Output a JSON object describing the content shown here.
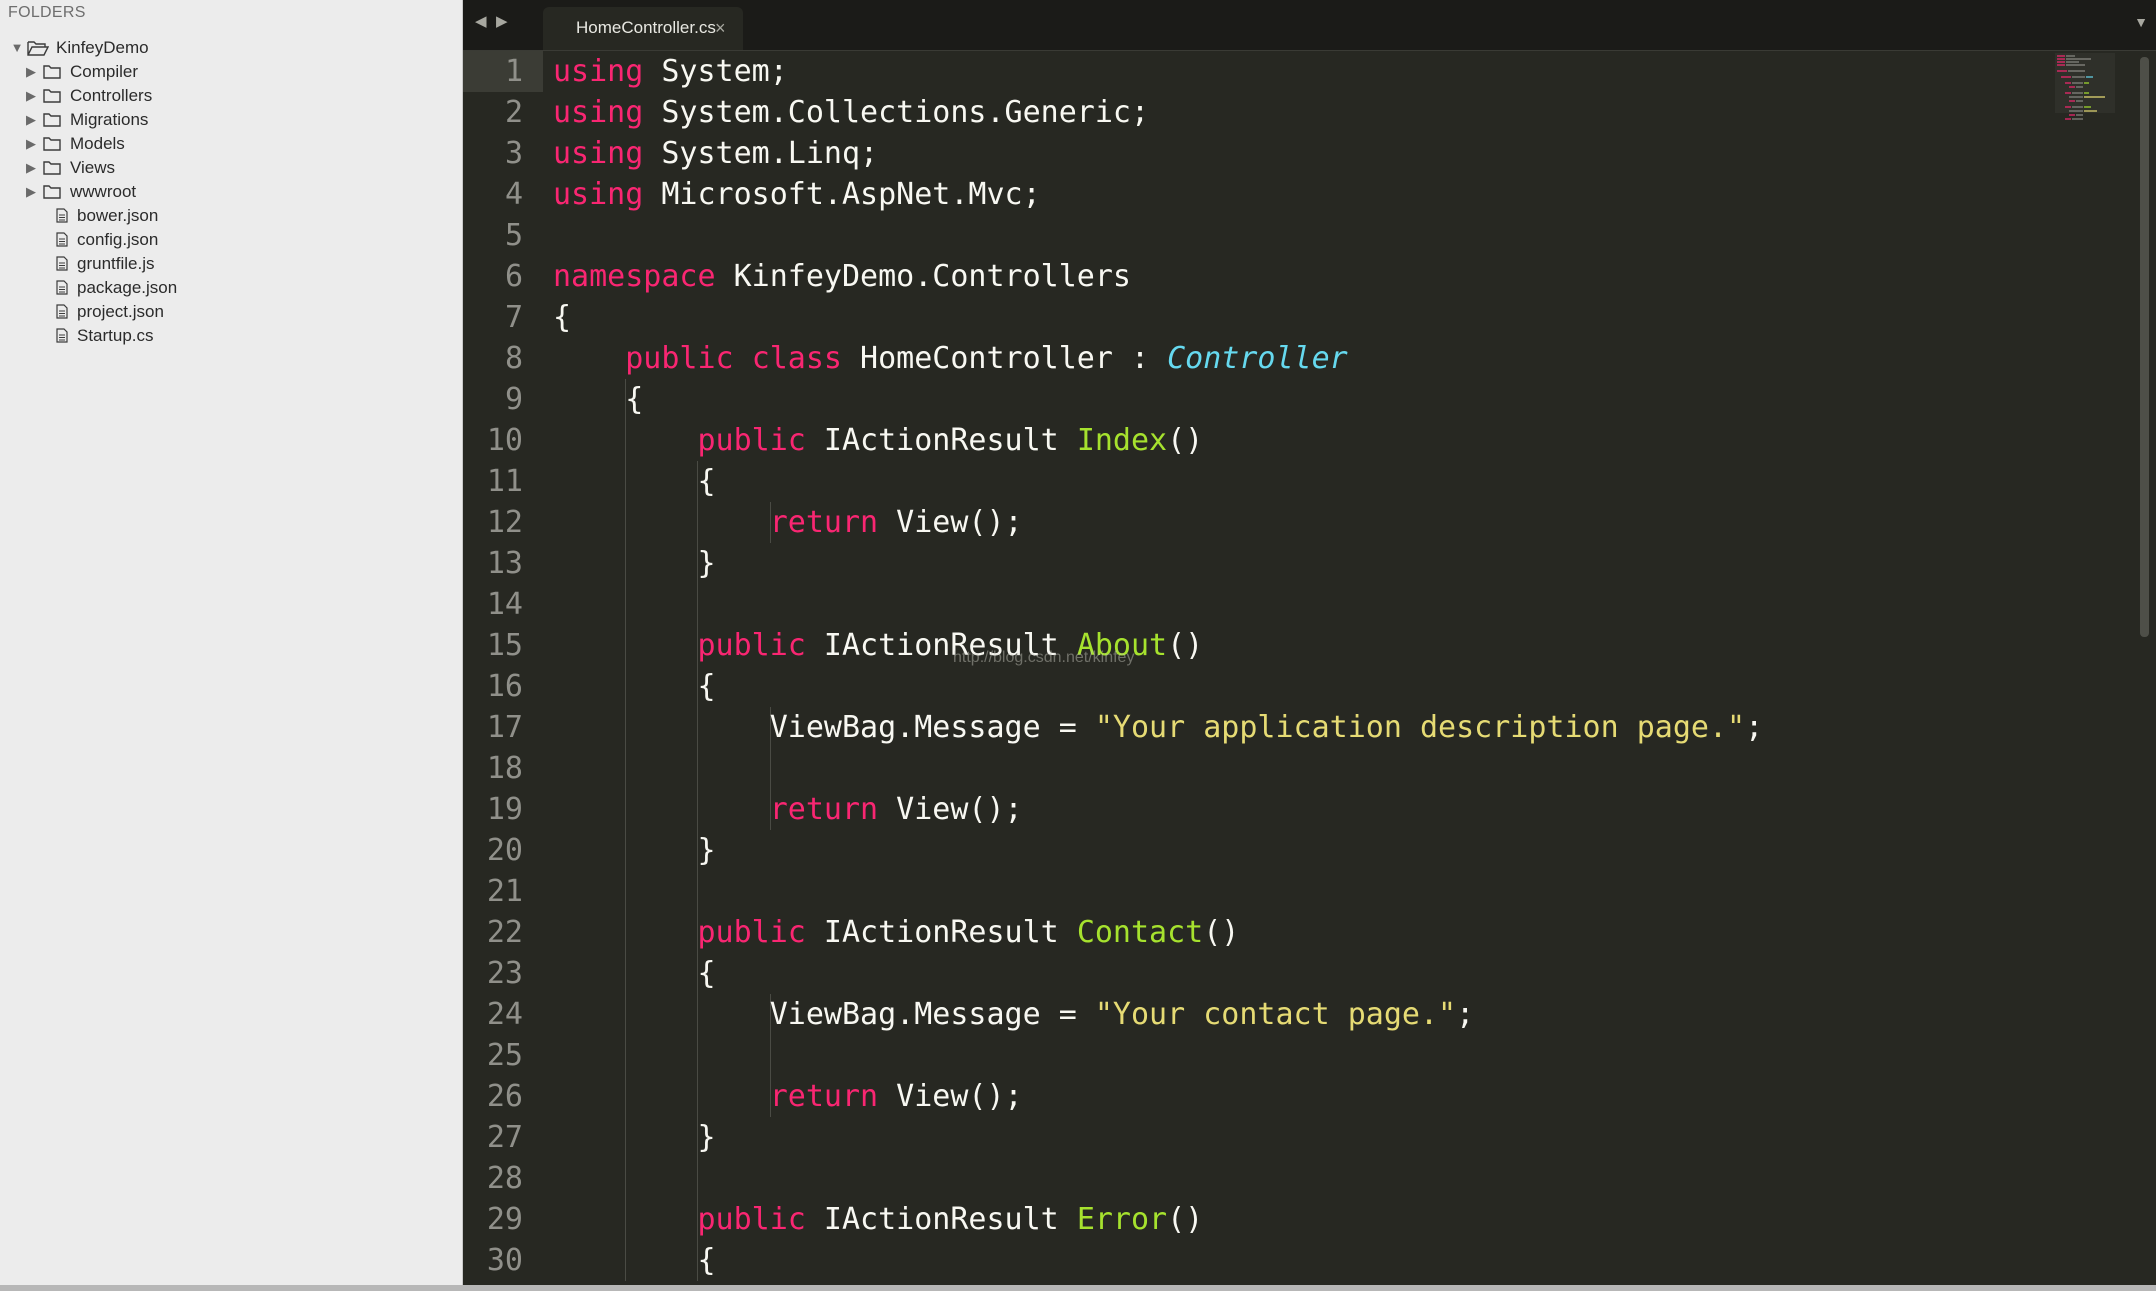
{
  "sidebar": {
    "header": "FOLDERS",
    "root": {
      "label": "KinfeyDemo",
      "icon": "folder-open-icon",
      "expanded": true
    },
    "folders": [
      {
        "label": "Compiler",
        "icon": "folder-icon"
      },
      {
        "label": "Controllers",
        "icon": "folder-icon"
      },
      {
        "label": "Migrations",
        "icon": "folder-icon"
      },
      {
        "label": "Models",
        "icon": "folder-icon"
      },
      {
        "label": "Views",
        "icon": "folder-icon"
      },
      {
        "label": "wwwroot",
        "icon": "folder-icon"
      }
    ],
    "files": [
      {
        "label": "bower.json",
        "icon": "file-icon"
      },
      {
        "label": "config.json",
        "icon": "file-icon"
      },
      {
        "label": "gruntfile.js",
        "icon": "file-icon"
      },
      {
        "label": "package.json",
        "icon": "file-icon"
      },
      {
        "label": "project.json",
        "icon": "file-icon"
      },
      {
        "label": "Startup.cs",
        "icon": "file-icon"
      }
    ]
  },
  "tabs": {
    "active": {
      "label": "HomeController.cs",
      "close_glyph": "×"
    },
    "nav_back_glyph": "◀",
    "nav_forward_glyph": "▶",
    "menu_glyph": "▼"
  },
  "editor": {
    "active_line": 1,
    "watermark": "http://blog.csdn.net/kinfey",
    "colors": {
      "background": "#272822",
      "keyword": "#f92672",
      "type": "#66d9ef",
      "function": "#a6e22e",
      "string": "#e6db74",
      "text": "#f8f8f2",
      "line_number": "#90908a"
    },
    "lines": [
      {
        "n": "1",
        "tokens": [
          [
            "kw",
            "using"
          ],
          [
            "id",
            " System;"
          ]
        ]
      },
      {
        "n": "2",
        "tokens": [
          [
            "kw",
            "using"
          ],
          [
            "id",
            " System.Collections.Generic;"
          ]
        ]
      },
      {
        "n": "3",
        "tokens": [
          [
            "kw",
            "using"
          ],
          [
            "id",
            " System.Linq;"
          ]
        ]
      },
      {
        "n": "4",
        "tokens": [
          [
            "kw",
            "using"
          ],
          [
            "id",
            " Microsoft.AspNet.Mvc;"
          ]
        ]
      },
      {
        "n": "5",
        "tokens": []
      },
      {
        "n": "6",
        "tokens": [
          [
            "kw",
            "namespace"
          ],
          [
            "id",
            " KinfeyDemo.Controllers"
          ]
        ]
      },
      {
        "n": "7",
        "tokens": [
          [
            "id",
            "{"
          ]
        ]
      },
      {
        "n": "8",
        "tokens": [
          [
            "id",
            "    "
          ],
          [
            "kw",
            "public"
          ],
          [
            "id",
            " "
          ],
          [
            "kw",
            "class"
          ],
          [
            "id",
            " HomeController : "
          ],
          [
            "type",
            "Controller"
          ]
        ]
      },
      {
        "n": "9",
        "tokens": [
          [
            "id",
            "    {"
          ]
        ]
      },
      {
        "n": "10",
        "tokens": [
          [
            "id",
            "        "
          ],
          [
            "kw",
            "public"
          ],
          [
            "id",
            " IActionResult "
          ],
          [
            "fn",
            "Index"
          ],
          [
            "id",
            "()"
          ]
        ]
      },
      {
        "n": "11",
        "tokens": [
          [
            "id",
            "        {"
          ]
        ]
      },
      {
        "n": "12",
        "tokens": [
          [
            "id",
            "            "
          ],
          [
            "kw",
            "return"
          ],
          [
            "id",
            " View();"
          ]
        ]
      },
      {
        "n": "13",
        "tokens": [
          [
            "id",
            "        }"
          ]
        ]
      },
      {
        "n": "14",
        "tokens": []
      },
      {
        "n": "15",
        "tokens": [
          [
            "id",
            "        "
          ],
          [
            "kw",
            "public"
          ],
          [
            "id",
            " IActionResult "
          ],
          [
            "fn",
            "About"
          ],
          [
            "id",
            "()"
          ]
        ]
      },
      {
        "n": "16",
        "tokens": [
          [
            "id",
            "        {"
          ]
        ]
      },
      {
        "n": "17",
        "tokens": [
          [
            "id",
            "            ViewBag.Message = "
          ],
          [
            "str",
            "\"Your application description page.\""
          ],
          [
            "id",
            ";"
          ]
        ]
      },
      {
        "n": "18",
        "tokens": []
      },
      {
        "n": "19",
        "tokens": [
          [
            "id",
            "            "
          ],
          [
            "kw",
            "return"
          ],
          [
            "id",
            " View();"
          ]
        ]
      },
      {
        "n": "20",
        "tokens": [
          [
            "id",
            "        }"
          ]
        ]
      },
      {
        "n": "21",
        "tokens": []
      },
      {
        "n": "22",
        "tokens": [
          [
            "id",
            "        "
          ],
          [
            "kw",
            "public"
          ],
          [
            "id",
            " IActionResult "
          ],
          [
            "fn",
            "Contact"
          ],
          [
            "id",
            "()"
          ]
        ]
      },
      {
        "n": "23",
        "tokens": [
          [
            "id",
            "        {"
          ]
        ]
      },
      {
        "n": "24",
        "tokens": [
          [
            "id",
            "            ViewBag.Message = "
          ],
          [
            "str",
            "\"Your contact page.\""
          ],
          [
            "id",
            ";"
          ]
        ]
      },
      {
        "n": "25",
        "tokens": []
      },
      {
        "n": "26",
        "tokens": [
          [
            "id",
            "            "
          ],
          [
            "kw",
            "return"
          ],
          [
            "id",
            " View();"
          ]
        ]
      },
      {
        "n": "27",
        "tokens": [
          [
            "id",
            "        }"
          ]
        ]
      },
      {
        "n": "28",
        "tokens": []
      },
      {
        "n": "29",
        "tokens": [
          [
            "id",
            "        "
          ],
          [
            "kw",
            "public"
          ],
          [
            "id",
            " IActionResult "
          ],
          [
            "fn",
            "Error"
          ],
          [
            "id",
            "()"
          ]
        ]
      },
      {
        "n": "30",
        "tokens": [
          [
            "id",
            "        {"
          ]
        ]
      }
    ]
  }
}
